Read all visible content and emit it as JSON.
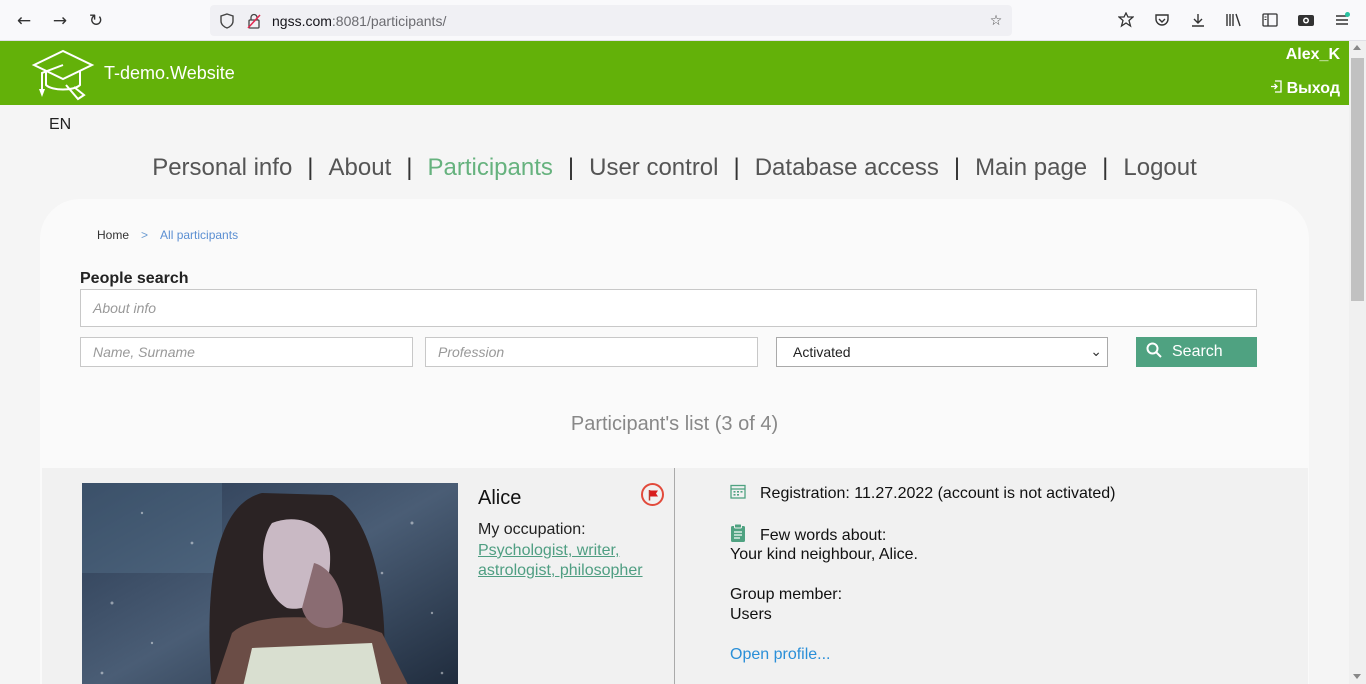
{
  "browser": {
    "url_host": "ngss.com",
    "url_path": ":8081/participants/",
    "icons": [
      "back-icon",
      "forward-icon",
      "reload-icon",
      "shield-icon",
      "lock-off-icon",
      "bookmark-star-icon",
      "extension-icon",
      "pocket-icon",
      "download-icon",
      "library-icon",
      "sidebar-icon",
      "screenshot-icon",
      "menu-icon"
    ]
  },
  "header": {
    "brand": "T-demo.Website",
    "user": "Alex_K",
    "logout": "Выход",
    "accent": "#63b109"
  },
  "lang": "EN",
  "nav": {
    "items": [
      {
        "label": "Personal info",
        "active": false
      },
      {
        "label": "About",
        "active": false
      },
      {
        "label": "Participants",
        "active": true
      },
      {
        "label": "User control",
        "active": false
      },
      {
        "label": "Database access",
        "active": false
      },
      {
        "label": "Main page",
        "active": false
      },
      {
        "label": "Logout",
        "active": false
      }
    ],
    "separator": "|"
  },
  "breadcrumb": {
    "home": "Home",
    "arrow": ">",
    "current": "All participants"
  },
  "search": {
    "label": "People search",
    "about_placeholder": "About info",
    "name_placeholder": "Name, Surname",
    "profession_placeholder": "Profession",
    "status_selected": "Activated",
    "button": "Search",
    "button_color": "#4fa281"
  },
  "list": {
    "title": "Participant's list (3 of 4)"
  },
  "participant": {
    "name": "Alice",
    "occupation_label": "My occupation:",
    "occupation": "Psychologist, writer, astrologist, philosopher",
    "registration": "Registration: 11.27.2022 (account is not activated)",
    "few_words_label": "Few words about:",
    "few_words": "Your kind neighbour, Alice.",
    "group_label": "Group member:",
    "group": "Users",
    "open_profile": "Open profile..."
  }
}
